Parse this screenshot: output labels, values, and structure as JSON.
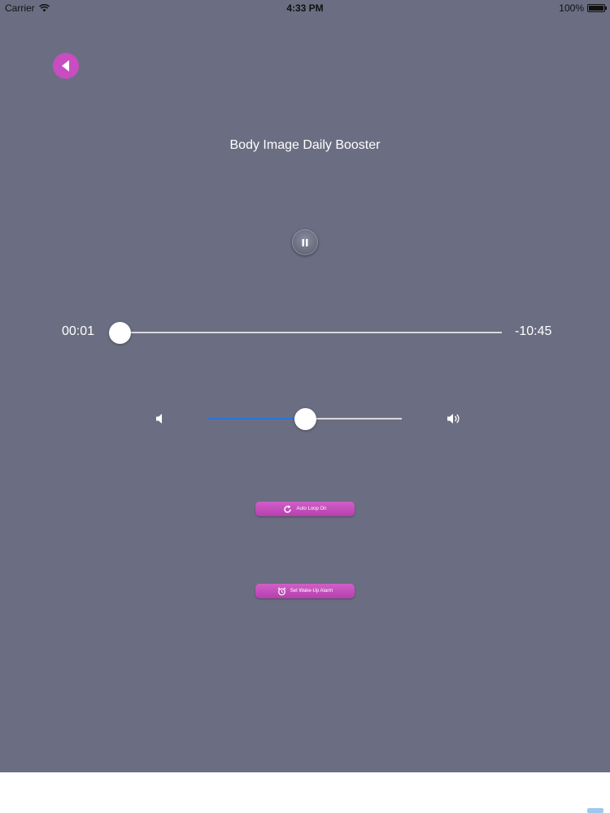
{
  "status_bar": {
    "carrier": "Carrier",
    "time": "4:33 PM",
    "battery": "100%"
  },
  "back_icon": "back-arrow-icon",
  "title": "Body Image Daily Booster",
  "player": {
    "state": "playing",
    "pause_icon": "pause-icon",
    "elapsed": "00:01",
    "remaining": "-10:45",
    "progress": 0.0,
    "volume": 0.5
  },
  "buttons": {
    "auto_loop": "Auto Loop On",
    "wake_alarm": "Set Wake-Up Alarm"
  },
  "colors": {
    "background": "#6b6e82",
    "accent": "#c84dc0",
    "volume_fill": "#2a74d8"
  }
}
